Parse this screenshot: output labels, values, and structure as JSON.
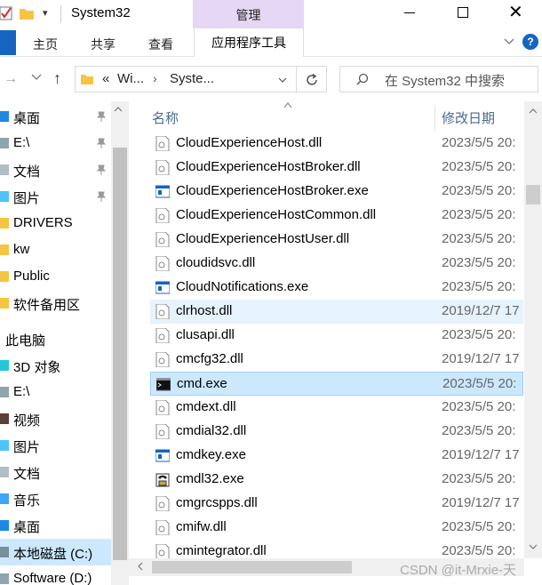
{
  "window": {
    "title": "System32",
    "manage_tab": "管理"
  },
  "ribbon": {
    "tabs": [
      "主页",
      "共享",
      "查看"
    ],
    "app_tools_tab": "应用程序工具",
    "help": "?"
  },
  "address": {
    "prefix": "«",
    "crumbs": [
      "Wi...",
      "Syste..."
    ],
    "search_placeholder": "在 System32 中搜索"
  },
  "nav": {
    "items": [
      {
        "label": "桌面",
        "icon": "desktop-icon",
        "pinned": true
      },
      {
        "label": "E:\\",
        "icon": "drive-icon",
        "pinned": true
      },
      {
        "label": "文档",
        "icon": "documents-icon",
        "pinned": true
      },
      {
        "label": "图片",
        "icon": "pictures-icon",
        "pinned": true
      },
      {
        "label": "DRIVERS",
        "icon": "folder-icon",
        "pinned": false
      },
      {
        "label": "kw",
        "icon": "folder-icon",
        "pinned": false
      },
      {
        "label": "Public",
        "icon": "folder-icon",
        "pinned": false
      },
      {
        "label": "软件备用区",
        "icon": "folder-icon",
        "pinned": false
      },
      {
        "label": "此电脑",
        "icon": "this-pc-icon",
        "pinned": false
      },
      {
        "label": "3D 对象",
        "icon": "3d-objects-icon",
        "pinned": false
      },
      {
        "label": "E:\\",
        "icon": "drive-icon",
        "pinned": false
      },
      {
        "label": "视频",
        "icon": "videos-icon",
        "pinned": false
      },
      {
        "label": "图片",
        "icon": "pictures-icon",
        "pinned": false
      },
      {
        "label": "文档",
        "icon": "documents-icon",
        "pinned": false
      },
      {
        "label": "音乐",
        "icon": "music-icon",
        "pinned": false
      },
      {
        "label": "桌面",
        "icon": "desktop-icon",
        "pinned": false
      },
      {
        "label": "本地磁盘 (C:)",
        "icon": "local-disk-icon",
        "pinned": false
      },
      {
        "label": "Software (D:)",
        "icon": "drive-icon",
        "pinned": false
      }
    ]
  },
  "filelist": {
    "col_name": "名称",
    "col_date": "修改日期",
    "rows": [
      {
        "name": "CloudExperienceHost.dll",
        "date": "2023/5/5 20:",
        "icon": "dll-icon"
      },
      {
        "name": "CloudExperienceHostBroker.dll",
        "date": "2023/5/5 20:",
        "icon": "dll-icon"
      },
      {
        "name": "CloudExperienceHostBroker.exe",
        "date": "2023/5/5 20:",
        "icon": "exe-icon"
      },
      {
        "name": "CloudExperienceHostCommon.dll",
        "date": "2023/5/5 20:",
        "icon": "dll-icon"
      },
      {
        "name": "CloudExperienceHostUser.dll",
        "date": "2023/5/5 20:",
        "icon": "dll-icon"
      },
      {
        "name": "cloudidsvc.dll",
        "date": "2023/5/5 20:",
        "icon": "dll-icon"
      },
      {
        "name": "CloudNotifications.exe",
        "date": "2023/5/5 20:",
        "icon": "exe-icon"
      },
      {
        "name": "clrhost.dll",
        "date": "2019/12/7 17",
        "icon": "dll-icon"
      },
      {
        "name": "clusapi.dll",
        "date": "2023/5/5 20:",
        "icon": "dll-icon"
      },
      {
        "name": "cmcfg32.dll",
        "date": "2019/12/7 17",
        "icon": "dll-icon"
      },
      {
        "name": "cmd.exe",
        "date": "2023/5/5 20:",
        "icon": "cmd-icon"
      },
      {
        "name": "cmdext.dll",
        "date": "2023/5/5 20:",
        "icon": "dll-icon"
      },
      {
        "name": "cmdial32.dll",
        "date": "2023/5/5 20:",
        "icon": "dll-icon"
      },
      {
        "name": "cmdkey.exe",
        "date": "2019/12/7 17",
        "icon": "exe-icon"
      },
      {
        "name": "cmdl32.exe",
        "date": "2023/5/5 20:",
        "icon": "phone-exe-icon"
      },
      {
        "name": "cmgrcspps.dll",
        "date": "2019/12/7 17",
        "icon": "dll-icon"
      },
      {
        "name": "cmifw.dll",
        "date": "2023/5/5 20:",
        "icon": "dll-icon"
      },
      {
        "name": "cmintegrator.dll",
        "date": "2023/5/5 20:",
        "icon": "dll-icon"
      }
    ]
  },
  "watermark": "CSDN @it-Mrxie-天",
  "colors": {
    "selection": "#cce8ff",
    "hover": "#e5f3ff",
    "manage_tab": "#e6d7f4",
    "accent": "#1565c0"
  }
}
